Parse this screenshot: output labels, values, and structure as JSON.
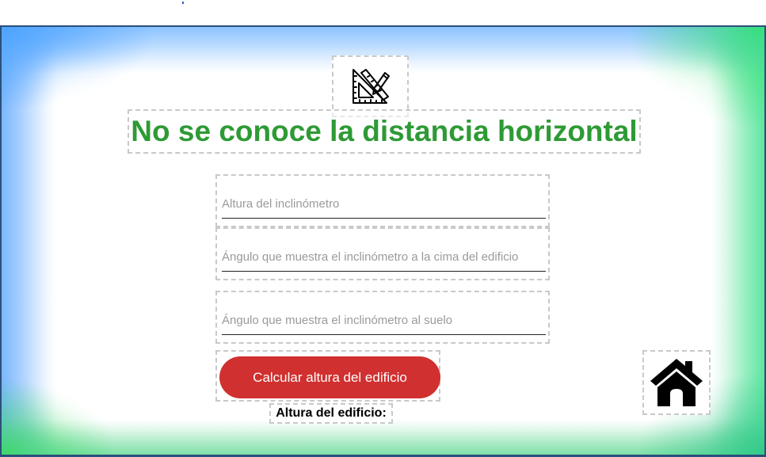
{
  "screen": {
    "title": "No se conoce la distancia horizontal",
    "logo_icon": "set-square-ruler-pencil-icon"
  },
  "form": {
    "fields": [
      {
        "placeholder": "Altura del inclinómetro",
        "value": ""
      },
      {
        "placeholder": "Ángulo que muestra el inclinómetro a la cima del edificio",
        "value": ""
      },
      {
        "placeholder": "Ángulo que muestra el inclinómetro al suelo",
        "value": ""
      }
    ],
    "calculate_label": "Calcular altura del edificio",
    "result_label": "Altura del edificio:"
  },
  "nav": {
    "home_icon": "home-icon"
  },
  "colors": {
    "title": "#2e9a35",
    "button": "#d0302f",
    "frame_border": "#2b4f7a"
  }
}
